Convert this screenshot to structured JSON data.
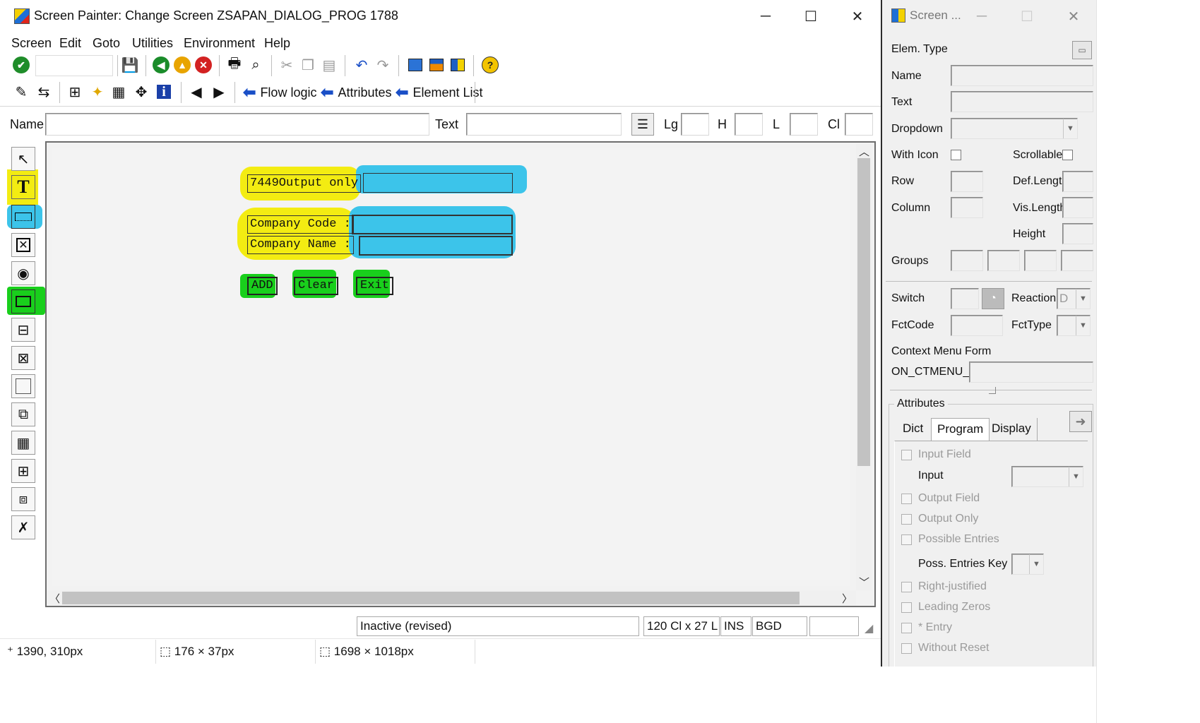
{
  "window": {
    "title": "Screen Painter:  Change Screen ZSAPAN_DIALOG_PROG 1788"
  },
  "menu": [
    "Screen",
    "Edit",
    "Goto",
    "Utilities",
    "Environment",
    "Help"
  ],
  "toolbar2": {
    "flow_logic": "Flow logic",
    "attributes": "Attributes",
    "element_list": "Element List"
  },
  "fieldbar": {
    "name_label": "Name",
    "text_label": "Text",
    "lg_label": "Lg",
    "h_label": "H",
    "l_label": "L",
    "cl_label": "Cl"
  },
  "canvas": {
    "output_label": "7449Output only",
    "company_code_label": "Company Code :",
    "company_name_label": "Company Name :",
    "buttons": [
      "ADD",
      "Clear",
      "Exit"
    ]
  },
  "status": {
    "state": "Inactive (revised)",
    "size": "120 Cl x 27 L",
    "mode": "INS",
    "system": "BGD"
  },
  "infobar": {
    "cursor": "1390, 310px",
    "selection": "176 × 37px",
    "image": "1698 × 1018px"
  },
  "attr_window": {
    "title": "Screen ...",
    "elem_type": "Elem. Type",
    "name": "Name",
    "text": "Text",
    "dropdown": "Dropdown",
    "with_icon": "With Icon",
    "scrollable": "Scrollable",
    "row": "Row",
    "def_length": "Def.Lengt",
    "column": "Column",
    "vis_length": "Vis.Length",
    "height": "Height",
    "groups": "Groups",
    "switch": "Switch",
    "reaction": "Reaction",
    "reaction_value": "D",
    "fctcode": "FctCode",
    "fcttype": "FctType",
    "context_menu": "Context Menu Form",
    "on_ctmenu": "ON_CTMENU_",
    "attributes": "Attributes",
    "tabs": [
      "Dict",
      "Program",
      "Display"
    ],
    "input_field": "Input Field",
    "input": "Input",
    "output_field": "Output Field",
    "output_only": "Output Only",
    "possible_entries": "Possible Entries",
    "poss_entries_key": "Poss. Entries Key",
    "right_justified": "Right-justified",
    "leading_zeros": "Leading Zeros",
    "entry": "* Entry",
    "without_reset": "Without Reset"
  },
  "colors": {
    "highlight_yellow": "#f3ec12",
    "highlight_blue": "#3cc4ea",
    "highlight_green": "#19cf1c",
    "nav_arrow": "#1a4fc7"
  }
}
